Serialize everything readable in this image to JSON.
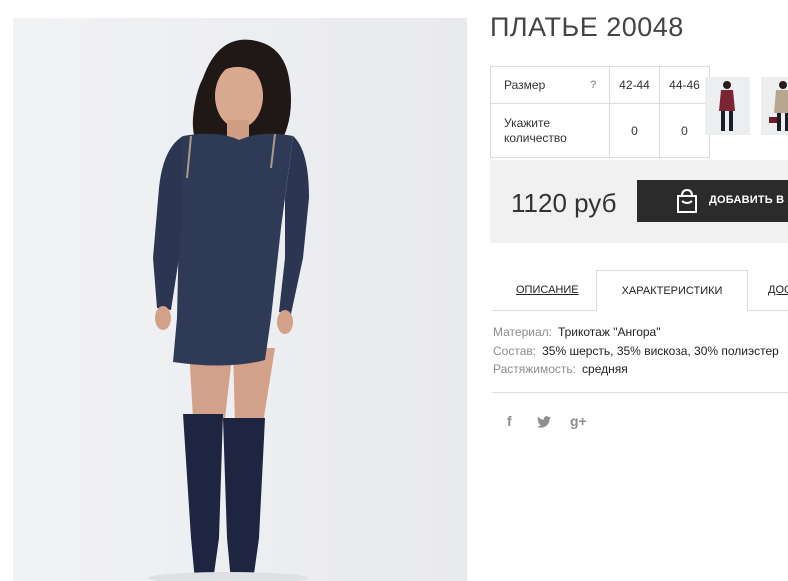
{
  "product": {
    "title": "ПЛАТЬЕ 20048"
  },
  "sizes": {
    "header_label": "Размер",
    "help_glyph": "?",
    "columns": [
      "42-44",
      "44-46"
    ],
    "quantity_label_line1": "Укажите",
    "quantity_label_line2": "количество",
    "quantities": [
      "0",
      "0"
    ]
  },
  "thumbnails": [
    {
      "name": "thumbnail-burgundy-dress",
      "color": "#7a2434"
    },
    {
      "name": "thumbnail-beige-dress",
      "color": "#b8a590"
    }
  ],
  "price": {
    "text": "1120 руб",
    "add_button_label": "ДОБАВИТЬ В З"
  },
  "tabs": {
    "description": "ОПИСАНИЕ",
    "characteristics": "ХАРАКТЕРИСТИКИ",
    "delivery": "ДОС"
  },
  "characteristics": [
    {
      "key": "Материал:",
      "value": "Трикотаж \"Ангора\""
    },
    {
      "key": "Состав:",
      "value": "35% шерсть, 35% вискоза, 30% полиэстер"
    },
    {
      "key": "Растяжимость:",
      "value": "средняя"
    }
  ],
  "social": {
    "facebook": "f",
    "twitter_icon": "twitter-bird",
    "googleplus": "g+"
  },
  "colors": {
    "dress": "#2f3a57",
    "boots": "#1e2540",
    "photo_bg": "#eeeff2",
    "button_bg": "#2b2b2b",
    "price_bg": "#f1f1f1"
  }
}
